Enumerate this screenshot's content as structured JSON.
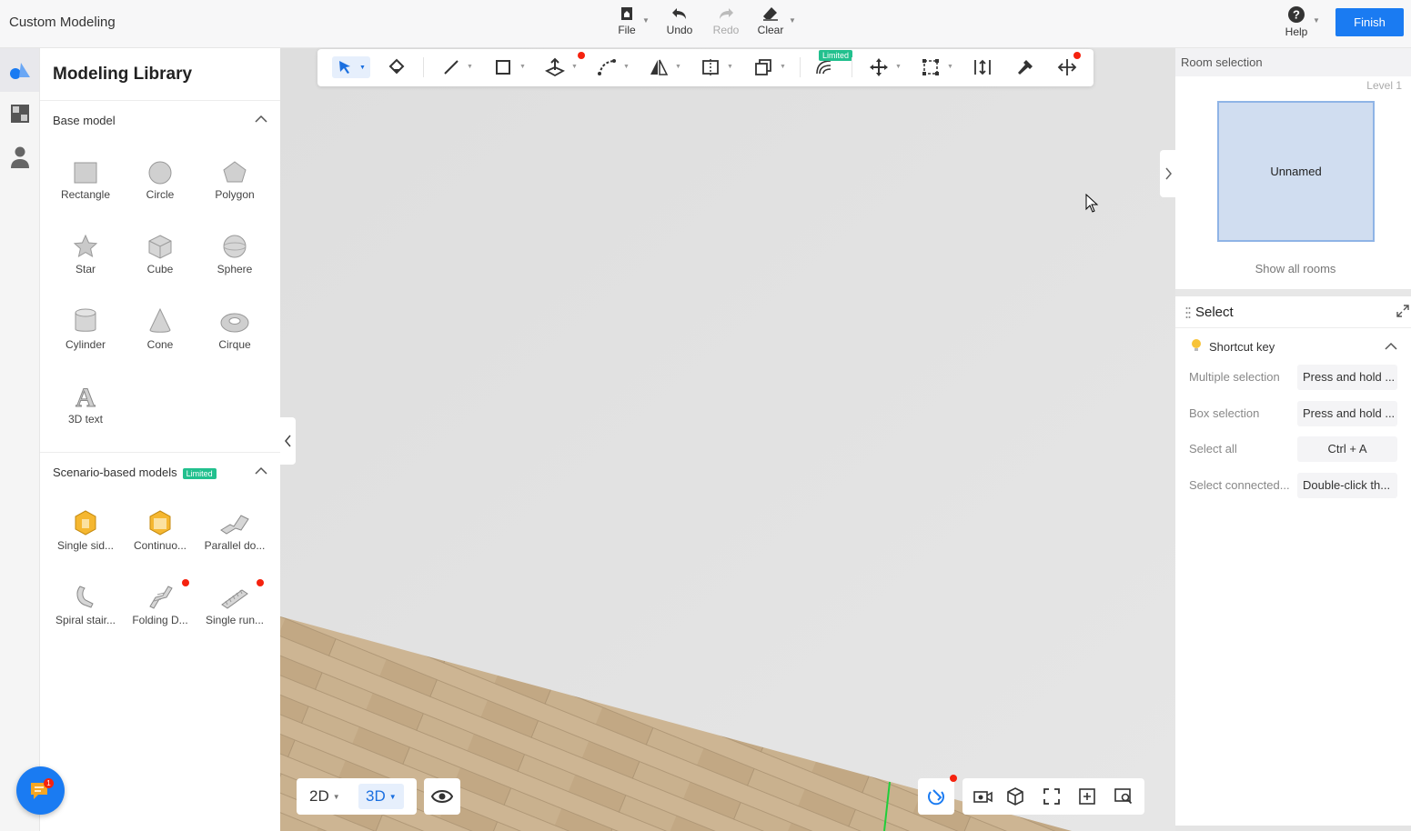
{
  "app": {
    "title": "Custom Modeling"
  },
  "header": {
    "file_label": "File",
    "undo_label": "Undo",
    "redo_label": "Redo",
    "clear_label": "Clear",
    "help_label": "Help",
    "finish_label": "Finish"
  },
  "rail": {
    "items": [
      "modeling-icon",
      "material-icon",
      "user-icon"
    ]
  },
  "library": {
    "title": "Modeling Library",
    "base_section": {
      "title": "Base model",
      "items": [
        {
          "label": "Rectangle",
          "icon": "rectangle-icon"
        },
        {
          "label": "Circle",
          "icon": "circle-icon"
        },
        {
          "label": "Polygon",
          "icon": "polygon-icon"
        },
        {
          "label": "Star",
          "icon": "star-icon"
        },
        {
          "label": "Cube",
          "icon": "cube-icon"
        },
        {
          "label": "Sphere",
          "icon": "sphere-icon"
        },
        {
          "label": "Cylinder",
          "icon": "cylinder-icon"
        },
        {
          "label": "Cone",
          "icon": "cone-icon"
        },
        {
          "label": "Cirque",
          "icon": "cirque-icon"
        },
        {
          "label": "3D text",
          "icon": "3d-text-icon"
        }
      ]
    },
    "scenario_section": {
      "title": "Scenario-based models",
      "badge": "Limited",
      "items": [
        {
          "label": "Single sid...",
          "icon": "single-side-icon"
        },
        {
          "label": "Continuo...",
          "icon": "continuous-icon"
        },
        {
          "label": "Parallel do...",
          "icon": "parallel-door-icon"
        },
        {
          "label": "Spiral stair...",
          "icon": "spiral-stair-icon"
        },
        {
          "label": "Folding D...",
          "icon": "folding-door-icon"
        },
        {
          "label": "Single run...",
          "icon": "single-run-icon"
        }
      ]
    }
  },
  "toolbar": {
    "limited_badge": "Limited"
  },
  "view": {
    "mode_2d": "2D",
    "mode_3d": "3D",
    "active": "3D"
  },
  "room_panel": {
    "title": "Room selection",
    "level": "Level 1",
    "room_name": "Unnamed",
    "show_all": "Show all rooms"
  },
  "select_panel": {
    "title": "Select",
    "shortcut_title": "Shortcut key",
    "shortcuts": [
      {
        "label": "Multiple selection",
        "value": "Press and hold ..."
      },
      {
        "label": "Box selection",
        "value": "Press and hold ..."
      },
      {
        "label": "Select all",
        "value": "Ctrl + A"
      },
      {
        "label": "Select connected...",
        "value": "Double-click th..."
      }
    ]
  },
  "chat": {
    "badge": "1"
  },
  "colors": {
    "accent": "#1a7bf2",
    "limited": "#22c08e",
    "alert": "#f5220e"
  }
}
